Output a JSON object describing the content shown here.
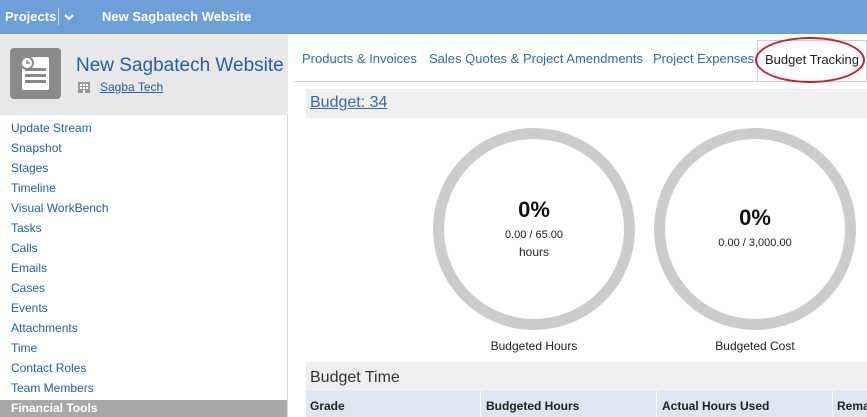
{
  "topbar": {
    "projects_label": "Projects",
    "breadcrumb": "New Sagbatech Website",
    "dropdown_icon": "chevron-down-icon"
  },
  "project": {
    "title": "New Sagbatech Website",
    "organization": "Sagba Tech",
    "avatar_icon": "project-document-icon",
    "org_icon": "building-icon"
  },
  "nav": {
    "items": [
      {
        "label": "Update Stream"
      },
      {
        "label": "Snapshot"
      },
      {
        "label": "Stages"
      },
      {
        "label": "Timeline"
      },
      {
        "label": "Visual WorkBench"
      },
      {
        "label": "Tasks"
      },
      {
        "label": "Calls"
      },
      {
        "label": "Emails"
      },
      {
        "label": "Cases"
      },
      {
        "label": "Events"
      },
      {
        "label": "Attachments"
      },
      {
        "label": "Time"
      },
      {
        "label": "Contact Roles"
      },
      {
        "label": "Team Members"
      },
      {
        "label": "Financial Tools"
      }
    ],
    "active_index": 14
  },
  "tabs": [
    {
      "label": "Products & Invoices"
    },
    {
      "label": "Sales Quotes & Project Amendments"
    },
    {
      "label": "Project Expenses"
    },
    {
      "label": "Budget Tracking"
    }
  ],
  "active_tab": "Budget Tracking",
  "budget": {
    "link_label": "Budget: 34"
  },
  "gauges": [
    {
      "percent": "0%",
      "value": "0.00 / 65.00",
      "unit": "hours",
      "label": "Budgeted Hours",
      "fraction": 0
    },
    {
      "percent": "0%",
      "value": "0.00 / 3,000.00",
      "unit": "",
      "label": "Budgeted Cost",
      "fraction": 0
    }
  ],
  "budget_time": {
    "title": "Budget Time",
    "columns": [
      "Grade",
      "Budgeted Hours",
      "Actual Hours Used",
      "Rema"
    ]
  },
  "colors": {
    "topbar": "#6f9fd8",
    "link": "#2460a8",
    "annotation_circle": "#d0202a",
    "gauge_ring": "#cccccc"
  }
}
